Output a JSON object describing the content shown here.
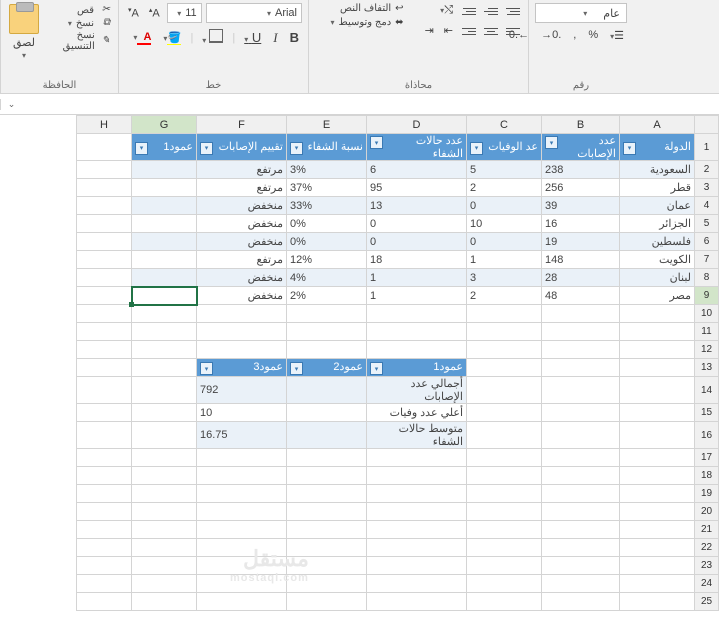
{
  "ribbon": {
    "clipboard": {
      "label": "الحافظة",
      "paste": "لصق",
      "cut": "قص",
      "copy": "نسخ",
      "format_painter": "نسخ التنسيق"
    },
    "font": {
      "label": "خط",
      "name": "Arial",
      "size": "11"
    },
    "align": {
      "label": "محاذاة",
      "wrap": "التفاف النص",
      "merge": "دمج وتوسيط"
    },
    "number": {
      "label": "رقم",
      "format": "عام"
    }
  },
  "colhdrs": [
    "A",
    "B",
    "C",
    "D",
    "E",
    "F",
    "G",
    "H"
  ],
  "t1": {
    "headers": [
      "الدولة",
      "عدد الإصابات",
      "عد الوفيات",
      "عدد حالات الشفاء",
      "نسبة الشفاء",
      "تقييم الإصابات",
      "عمود1"
    ],
    "rows": [
      [
        "السعودية",
        "238",
        "5",
        "6",
        "3%",
        "مرتفع",
        ""
      ],
      [
        "قطر",
        "256",
        "2",
        "95",
        "37%",
        "مرتفع",
        ""
      ],
      [
        "عمان",
        "39",
        "0",
        "13",
        "33%",
        "منخفض",
        ""
      ],
      [
        "الجزائر",
        "16",
        "10",
        "0",
        "0%",
        "منخفض",
        ""
      ],
      [
        "فلسطين",
        "19",
        "0",
        "0",
        "0%",
        "منخفض",
        ""
      ],
      [
        "الكويت",
        "148",
        "1",
        "18",
        "12%",
        "مرتفع",
        ""
      ],
      [
        "لبنان",
        "28",
        "3",
        "1",
        "4%",
        "منخفض",
        ""
      ],
      [
        "مصر",
        "48",
        "2",
        "1",
        "2%",
        "منخفض",
        ""
      ]
    ]
  },
  "t2": {
    "headers": [
      "عمود1",
      "عمود2",
      "عمود3"
    ],
    "rows": [
      [
        "أجمالي عدد الإصابات",
        "",
        "792"
      ],
      [
        "أعلي عدد وفيات",
        "",
        "10"
      ],
      [
        "متوسط حالات الشفاء",
        "",
        "16.75"
      ]
    ]
  },
  "watermark": {
    "big": "مستقل",
    "small": "mostaql.com"
  }
}
